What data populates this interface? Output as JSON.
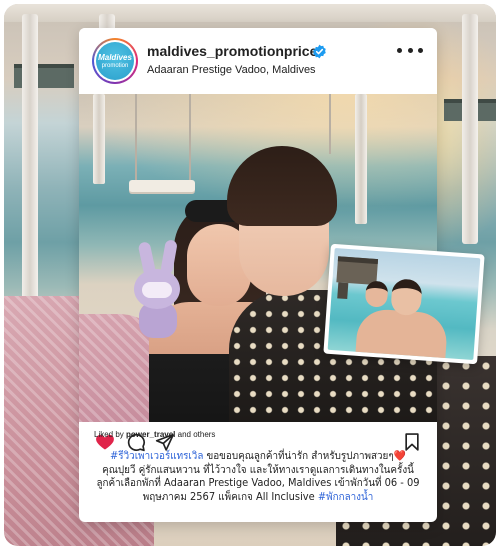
{
  "post": {
    "username": "maldives_promotionprice",
    "location": "Adaaran Prestige Vadoo, Maldives",
    "avatar": {
      "line1": "Maldives",
      "line2": "promotion"
    },
    "liked_by_prefix": "Liked by",
    "liked_by_user": "power_travel",
    "liked_by_suffix": "and others",
    "caption": {
      "line1_tag": "#รีวิวเพาเวอร์แทรเวิล",
      "line1_text": " ขอขอบคุณลูกค้าที่น่ารัก สำหรับรูปภาพสวยๆ",
      "line1_emoji": "❤️",
      "line2": "คุณปุยวี คู่รักแสนหวาน ที่ไว้วางใจ และให้ทางเราดูแลการเดินทางในครั้งนี้",
      "line3": "ลูกค้าเลือกพักที่ Adaaran Prestige Vadoo, Maldives เข้าพักวันที่ 06 - 09",
      "line4_text": "พฤษภาคม 2567 แพ็คเกจ All Inclusive ",
      "line4_tag": "#พักกลางน้ำ"
    }
  },
  "icons": {
    "verified": "verified-badge-icon",
    "more": "more-options-icon",
    "like": "heart-icon",
    "comment": "comment-icon",
    "share": "send-icon",
    "save": "bookmark-icon"
  },
  "colors": {
    "like": "#e0244a",
    "hashtag": "#2d63d8",
    "verified": "#1d9bf0",
    "text": "#222222"
  }
}
